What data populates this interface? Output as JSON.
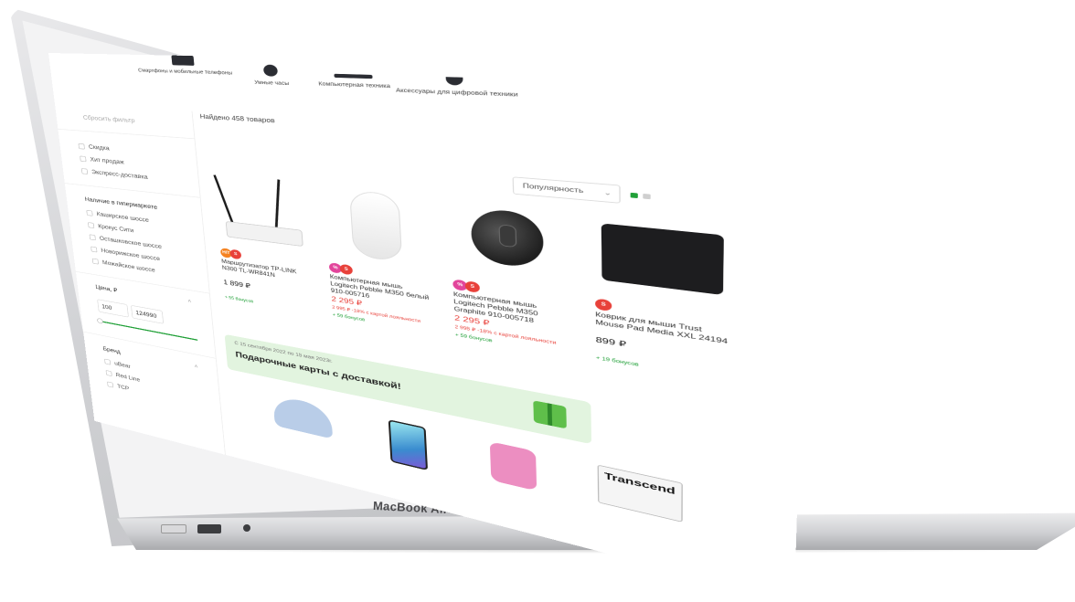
{
  "laptop": {
    "brand": "MacBook Air"
  },
  "categories": [
    {
      "label": "Смартфоны и мобильные телефоны"
    },
    {
      "label": "Умные часы"
    },
    {
      "label": "Компьютерная техника"
    },
    {
      "label": "Аксессуары для цифровой техники"
    }
  ],
  "sidebar": {
    "reset": "Сбросить фильтр",
    "quick": [
      "Скидка",
      "Хит продаж",
      "Экспресс-доставка"
    ],
    "stores_title": "Наличие в гипермаркете",
    "stores": [
      "Каширское шоссе",
      "Крокус Сити",
      "Осташковское шоссе",
      "Новорижское шоссе",
      "Можайское шоссе"
    ],
    "price_title": "Цена, ₽",
    "price_from": "100",
    "price_to": "124990",
    "brand_title": "Бренд",
    "brands": [
      "uBear",
      "Red Line",
      "TCP"
    ]
  },
  "main": {
    "found": "Найдено 458 товаров",
    "sort_label": "Популярность",
    "products": [
      {
        "name": "Маршрутизатор TP-LINK N300 TL-WR841N",
        "price": "1 899 ₽",
        "old_price": "",
        "bonus": "+ 55 бонусов",
        "badges": [
          "hit",
          "s"
        ]
      },
      {
        "name": "Компьютерная мышь Logitech Pebble M350 белый 910-005716",
        "price": "2 295 ₽",
        "old_price": "2 995 ₽  -18% с картой лояльности",
        "bonus": "+ 59 бонусов",
        "badges": [
          "pink",
          "s"
        ]
      },
      {
        "name": "Компьютерная мышь Logitech Pebble M350 Graphite 910-005718",
        "price": "2 295 ₽",
        "old_price": "2 995 ₽  -18% с картой лояльности",
        "bonus": "+ 59 бонусов",
        "badges": [
          "pink",
          "s"
        ]
      },
      {
        "name": "Коврик для мыши Trust Mouse Pad Media XXL 24194",
        "price": "899 ₽",
        "old_price": "",
        "bonus": "+ 19 бонусов",
        "badges": [
          "s"
        ]
      }
    ],
    "banner": {
      "date": "С 15 сентября 2022 по 15 мая 2023г.",
      "title": "Подарочные карты с доставкой!"
    },
    "bottom_brand": "Transcend"
  },
  "colors": {
    "accent": "#21a038",
    "sale": "#e8413a",
    "badge_pink": "#e2459b",
    "banner_bg": "#e2f4df"
  }
}
